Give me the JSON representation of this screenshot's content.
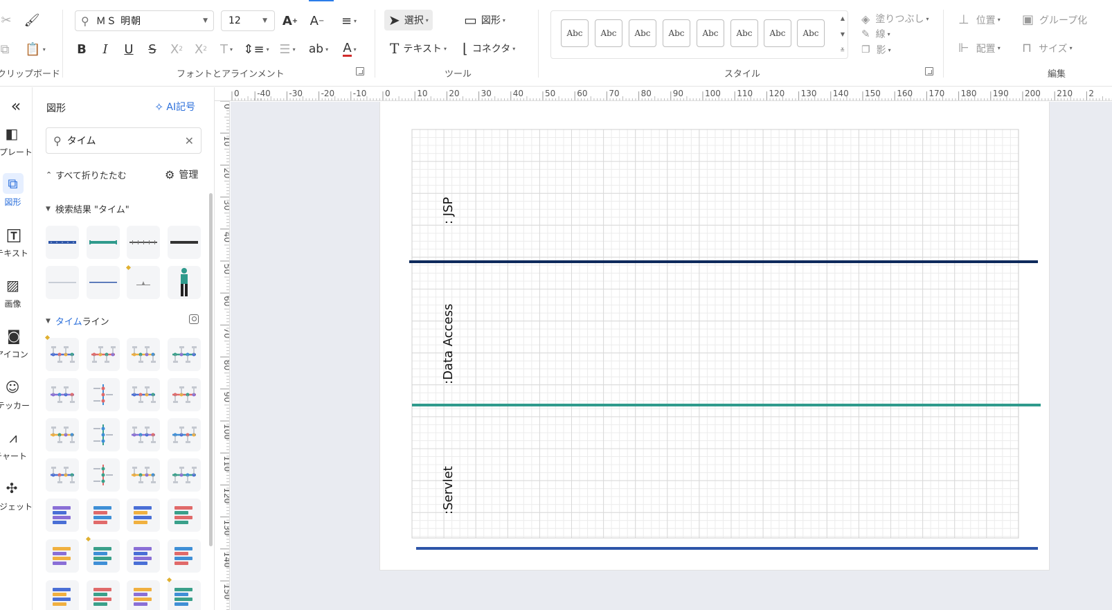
{
  "ribbon": {
    "clipboard": {
      "label": "クリップボード"
    },
    "font": {
      "family": "ＭＳ 明朝",
      "size": "12",
      "label": "フォントとアラインメント",
      "increase_icon": "font-size-increase-icon",
      "decrease_icon": "font-size-decrease-icon"
    },
    "tools": {
      "select": "選択",
      "shape": "図形",
      "text": "テキスト",
      "connector": "コネクタ",
      "label": "ツール"
    },
    "styles": {
      "presets": [
        "Abc",
        "Abc",
        "Abc",
        "Abc",
        "Abc",
        "Abc",
        "Abc",
        "Abc"
      ],
      "fill": "塗りつぶし",
      "line": "線",
      "shadow": "影",
      "label": "スタイル"
    },
    "arrange": {
      "position": "位置",
      "group": "グループ化",
      "align": "配置",
      "size": "サイズ",
      "label": "編集"
    }
  },
  "rail": {
    "items": [
      {
        "label": "テンプレート",
        "icon": "template-icon"
      },
      {
        "label": "図形",
        "icon": "shapes-icon",
        "active": true
      },
      {
        "label": "テキスト",
        "icon": "text-icon"
      },
      {
        "label": "画像",
        "icon": "image-icon"
      },
      {
        "label": "アイコン",
        "icon": "icon-library-icon"
      },
      {
        "label": "ステッカー",
        "icon": "sticker-icon"
      },
      {
        "label": "チャート",
        "icon": "chart-icon"
      },
      {
        "label": "ウィジェット",
        "icon": "widget-icon"
      }
    ]
  },
  "panel": {
    "title": "図形",
    "ai_label": "AI記号",
    "search_value": "タイム",
    "collapse_all": "すべて折りたたむ",
    "manage": "管理",
    "sections": {
      "search_results": "検索結果 \"タイム\"",
      "timeline_match": "タイム",
      "timeline_rest": "ライン"
    }
  },
  "ruler": {
    "h_labels": [
      "0",
      "-40",
      "-30",
      "-20",
      "-10",
      "0",
      "10",
      "20",
      "30",
      "40",
      "50",
      "60",
      "70",
      "80",
      "90",
      "100",
      "110",
      "120",
      "130",
      "140",
      "150",
      "160",
      "170",
      "180",
      "190",
      "200",
      "210",
      "2"
    ],
    "v_labels": [
      "0",
      "10",
      "20",
      "30",
      "40",
      "50",
      "60",
      "70",
      "80",
      "90",
      "100",
      "110",
      "120",
      "130",
      "140",
      "150"
    ]
  },
  "diagram": {
    "lanes": [
      {
        "label": ": JSP",
        "line_color": "#0e2a5c"
      },
      {
        "label": ":Data Access",
        "line_color": "#2f9a8c"
      },
      {
        "label": ":Servlet",
        "line_color": "#2d55a8"
      }
    ],
    "grid_color": "#d9d9d9"
  },
  "colors": {
    "accent": "#2b6fdb",
    "canvas_bg": "#e9ebf1"
  }
}
